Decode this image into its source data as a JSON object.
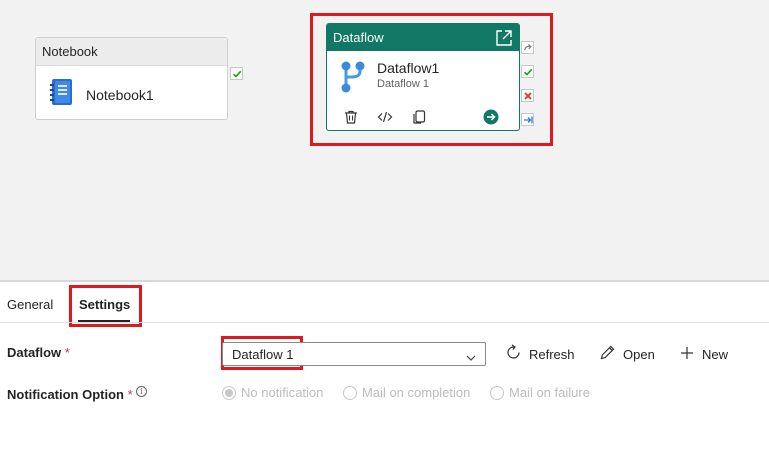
{
  "canvas": {
    "notebook_activity": {
      "header": "Notebook",
      "name": "Notebook1",
      "icon": "notebook-icon"
    },
    "dataflow_activity": {
      "header": "Dataflow",
      "name": "Dataflow1",
      "subtitle": "Dataflow 1",
      "icon": "dataflow-branch-icon",
      "actions": [
        "delete-icon",
        "code-icon",
        "copy-icon",
        "go-arrow-icon"
      ],
      "side_icons": [
        "skip-icon",
        "success-check-icon",
        "fail-x-icon",
        "completion-arrow-icon"
      ]
    }
  },
  "tabs": [
    {
      "label": "General",
      "active": false
    },
    {
      "label": "Settings",
      "active": true
    }
  ],
  "settings": {
    "dataflow_label": "Dataflow",
    "required_mark": "*",
    "dataflow_value": "Dataflow 1",
    "refresh_label": "Refresh",
    "open_label": "Open",
    "new_label": "New",
    "notification_label": "Notification Option",
    "notification_options": [
      {
        "label": "No notification",
        "selected": true
      },
      {
        "label": "Mail on completion",
        "selected": false
      },
      {
        "label": "Mail on failure",
        "selected": false
      }
    ]
  },
  "colors": {
    "accent": "#117865",
    "highlight": "#e0181f",
    "canvas": "#f2f2f2"
  }
}
